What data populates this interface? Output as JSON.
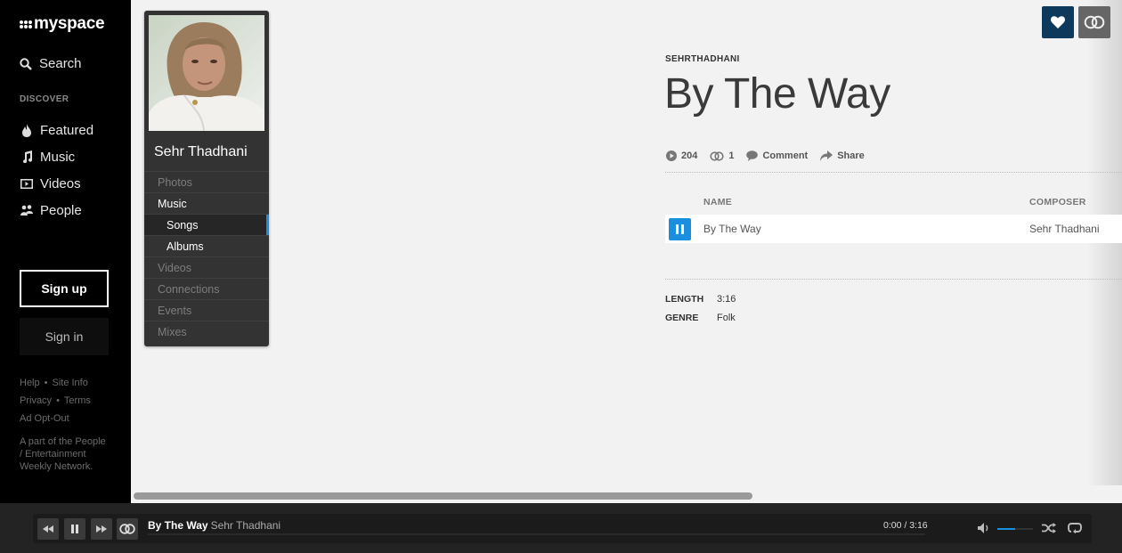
{
  "nav": {
    "logo": "myspace",
    "search_label": "Search",
    "section_label": "DISCOVER",
    "items": [
      {
        "label": "Featured",
        "icon": "flame-icon"
      },
      {
        "label": "Music",
        "icon": "music-note-icon"
      },
      {
        "label": "Videos",
        "icon": "video-icon"
      },
      {
        "label": "People",
        "icon": "people-icon"
      }
    ],
    "signup_label": "Sign up",
    "signin_label": "Sign in",
    "footer_links": {
      "help": "Help",
      "site_info": "Site Info",
      "privacy": "Privacy",
      "terms": "Terms",
      "ad_opt_out": "Ad Opt-Out"
    },
    "network_text": "A part of the People / Entertainment Weekly Network."
  },
  "profile": {
    "name": "Sehr Thadhani",
    "menu": [
      {
        "label": "Photos",
        "state": "inactive"
      },
      {
        "label": "Music",
        "state": "active"
      },
      {
        "label": "Songs",
        "state": "selected-sub"
      },
      {
        "label": "Albums",
        "state": "sub"
      },
      {
        "label": "Videos",
        "state": "inactive"
      },
      {
        "label": "Connections",
        "state": "inactive"
      },
      {
        "label": "Events",
        "state": "inactive"
      },
      {
        "label": "Mixes",
        "state": "inactive"
      }
    ]
  },
  "song": {
    "artist_handle": "SEHRTHADHANI",
    "title": "By The Way",
    "plays": "204",
    "connections": "1",
    "comment_label": "Comment",
    "share_label": "Share",
    "columns": {
      "name": "NAME",
      "composer": "COMPOSER"
    },
    "tracks": [
      {
        "name": "By The Way",
        "composer": "Sehr Thadhani",
        "playing": true
      }
    ],
    "meta": {
      "length_label": "LENGTH",
      "length_value": "3:16",
      "genre_label": "GENRE",
      "genre_value": "Folk"
    }
  },
  "actions": {
    "like_icon": "heart-icon",
    "connect_icon": "connect-rings-icon"
  },
  "player": {
    "now_title": "By The Way",
    "now_artist": "Sehr Thadhani",
    "time": "0:00 / 3:16",
    "progress": 0,
    "volume": 0.5,
    "accent": "#1a8fe0"
  }
}
